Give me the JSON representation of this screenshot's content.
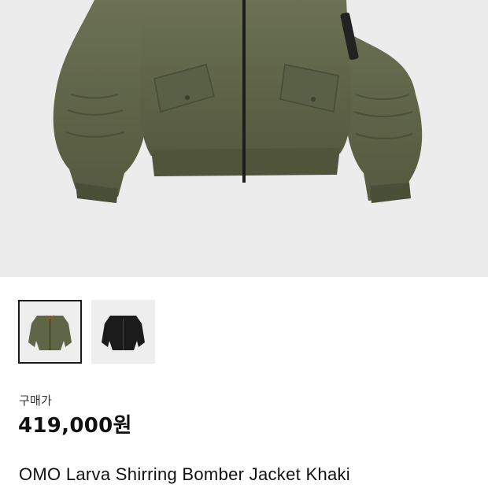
{
  "product": {
    "hero_image_icon": "khaki-bomber-jacket-photo",
    "thumbnails": [
      {
        "icon": "khaki-jacket-thumbnail",
        "color": "#5f6547",
        "selected": true
      },
      {
        "icon": "black-jacket-thumbnail",
        "color": "#1b1b1b",
        "selected": false
      }
    ],
    "price_label": "구매가",
    "price": "419,000원",
    "name": "OMO Larva Shirring Bomber Jacket Khaki"
  },
  "colors": {
    "khaki": "#5f6547",
    "black": "#1b1b1b",
    "hero_background": "#ececec"
  }
}
